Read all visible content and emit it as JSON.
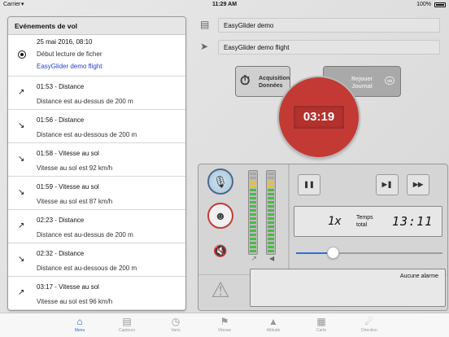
{
  "statusbar": {
    "carrier": "Carrier",
    "time": "11:29 AM",
    "battery": "100%"
  },
  "events": {
    "title": "Evénements de vol",
    "items": [
      {
        "icon": "bullet-icon",
        "line1": "25 mai 2016, 08:10",
        "line2": "Début lecture de ficher",
        "line3": "EasyGlider demo flight"
      },
      {
        "icon": "arrow-up-right-icon",
        "line1": "01:53 - Distance",
        "line2": "Distance est au-dessus de 200 m"
      },
      {
        "icon": "arrow-down-right-icon",
        "line1": "01:56 - Distance",
        "line2": "Distance est au-dessous de 200 m"
      },
      {
        "icon": "arrow-down-right-icon",
        "line1": "01:58 - Vitesse au sol",
        "line2": "Vitesse au sol est 92 km/h"
      },
      {
        "icon": "arrow-down-right-icon",
        "line1": "01:59 - Vitesse au sol",
        "line2": "Vitesse au sol est 87 km/h"
      },
      {
        "icon": "arrow-up-right-icon",
        "line1": "02:23 - Distance",
        "line2": "Distance est au-dessus de 200 m"
      },
      {
        "icon": "arrow-down-right-icon",
        "line1": "02:32 - Distance",
        "line2": "Distance est au-dessous de 200 m"
      },
      {
        "icon": "arrow-up-right-icon",
        "line1": "03:17 - Vitesse au sol",
        "line2": "Vitesse au sol est 96 km/h"
      }
    ]
  },
  "info": {
    "model": "EasyGlider demo",
    "flight": "EasyGlider demo flight"
  },
  "acquisition": {
    "label_line1": "Acquisition",
    "label_line2": "Données"
  },
  "replay": {
    "label_line1": "Rejouer",
    "label_line2": "Journal"
  },
  "recorder": {
    "timer": "03:19"
  },
  "player": {
    "speed": "1x",
    "time_label_line1": "Temps",
    "time_label_line2": "total",
    "total_time": "13:11",
    "progress": 0.25
  },
  "alarm": {
    "text": "Aucune alarme"
  },
  "vu_meters": {
    "left_level": 0.9,
    "right_level": 0.9
  },
  "tabs": [
    {
      "label": "Menu",
      "icon": "home-icon",
      "active": true
    },
    {
      "label": "Capteurs",
      "icon": "sensors-icon",
      "active": false
    },
    {
      "label": "Vario",
      "icon": "vario-gauge-icon",
      "active": false
    },
    {
      "label": "Vitesse",
      "icon": "speed-flags-icon",
      "active": false
    },
    {
      "label": "Altitude",
      "icon": "mountain-icon",
      "active": false
    },
    {
      "label": "Carte",
      "icon": "map-icon",
      "active": false
    },
    {
      "label": "Direction",
      "icon": "compass-icon",
      "active": false
    }
  ],
  "colors": {
    "accent": "#1f6ad9",
    "record": "#c33a35",
    "link": "#2a3fcf"
  }
}
